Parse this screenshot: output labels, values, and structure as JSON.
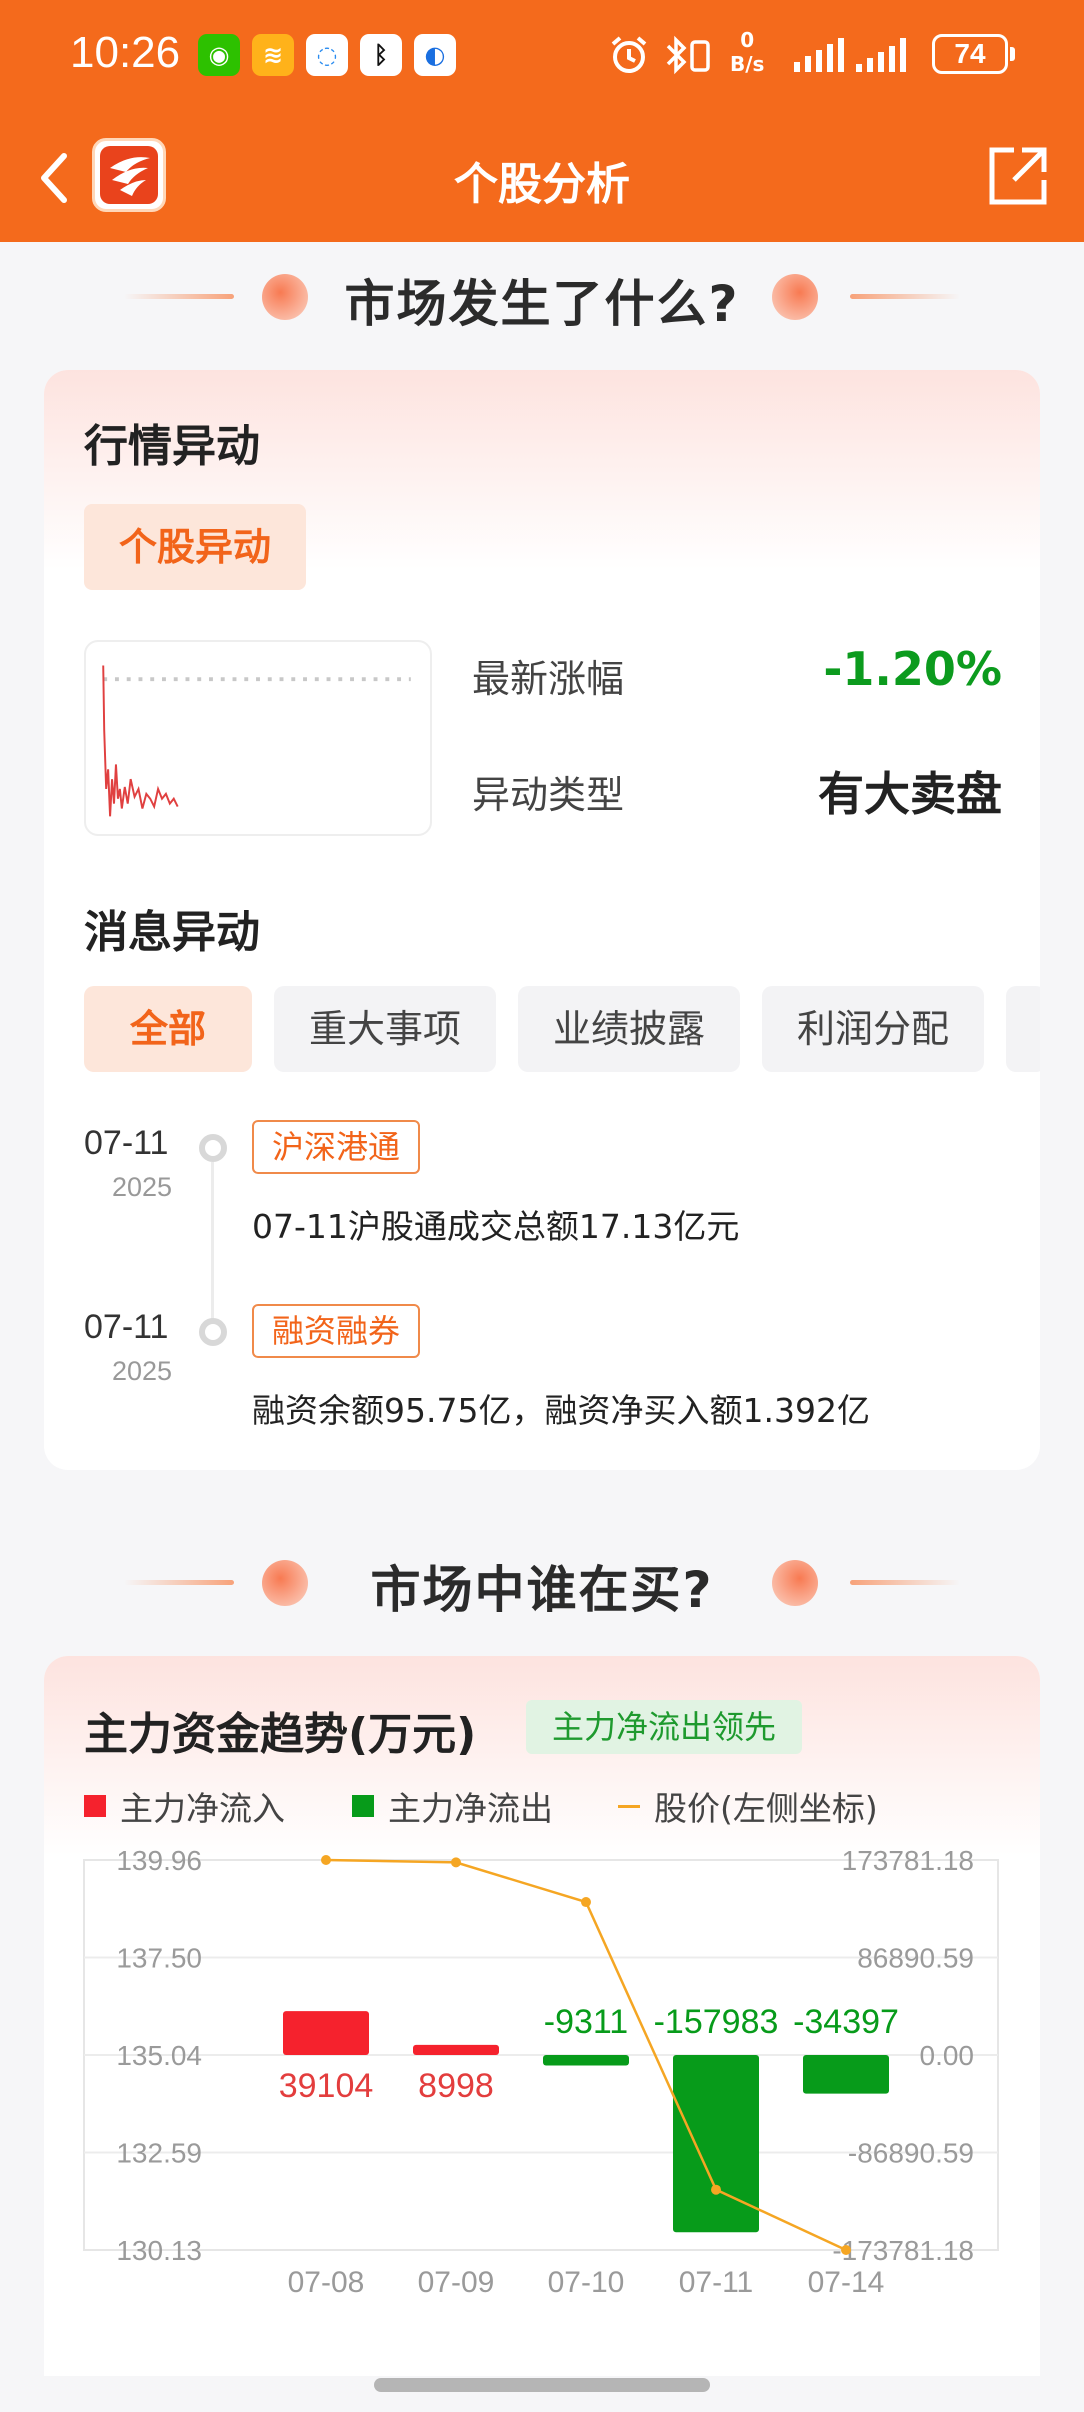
{
  "status_bar": {
    "time": "10:26",
    "net_speed_value": "0",
    "net_speed_unit": "B/s",
    "battery": "74"
  },
  "header": {
    "title": "个股分析",
    "back_icon": "chevron-left-icon",
    "share_icon": "share-icon"
  },
  "section1": {
    "banner": "市场发生了什么?",
    "market_anomaly": {
      "title": "行情异动",
      "tag": "个股异动",
      "latest_change_label": "最新涨幅",
      "latest_change_value": "-1.20%",
      "anomaly_type_label": "异动类型",
      "anomaly_type_value": "有大卖盘"
    },
    "news_anomaly": {
      "title": "消息异动",
      "filters": [
        "全部",
        "重大事项",
        "业绩披露",
        "利润分配"
      ],
      "active_filter": "全部",
      "items": [
        {
          "date": "07-11",
          "year": "2025",
          "tag": "沪深港通",
          "text": "07-11沪股通成交总额17.13亿元"
        },
        {
          "date": "07-11",
          "year": "2025",
          "tag": "融资融券",
          "text": "融资余额95.75亿，融资净买入额1.392亿"
        }
      ]
    }
  },
  "section2": {
    "banner": "市场中谁在买?",
    "fund_trend": {
      "title": "主力资金趋势(万元)",
      "badge": "主力净流出领先"
    }
  },
  "colors": {
    "brand_orange": "#f46a1c",
    "inflow_red": "#f5222d",
    "outflow_green": "#079b1a",
    "price_line": "#f5a623"
  },
  "chart_data": {
    "type": "bar",
    "categories": [
      "07-08",
      "07-09",
      "07-10",
      "07-11",
      "07-14"
    ],
    "series": [
      {
        "name": "主力净流入",
        "values": [
          39104,
          8998,
          null,
          null,
          null
        ]
      },
      {
        "name": "主力净流出",
        "values": [
          null,
          null,
          -9311,
          -157983,
          -34397
        ]
      }
    ],
    "line_series": {
      "name": "股价(左侧坐标)",
      "values": [
        139.96,
        139.9,
        138.9,
        131.65,
        130.13
      ]
    },
    "data_labels": [
      "39104",
      "8998",
      "-9311",
      "-157983",
      "-34397"
    ],
    "left_ticks": [
      "139.96",
      "137.50",
      "135.04",
      "132.59",
      "130.13"
    ],
    "right_ticks": [
      "173781.18",
      "86890.59",
      "0.00",
      "-86890.59",
      "-173781.18"
    ],
    "left_ylim": [
      130.13,
      139.96
    ],
    "right_ylim": [
      -173781.18,
      173781.18
    ],
    "grid": true,
    "legend_position": "top-left"
  }
}
